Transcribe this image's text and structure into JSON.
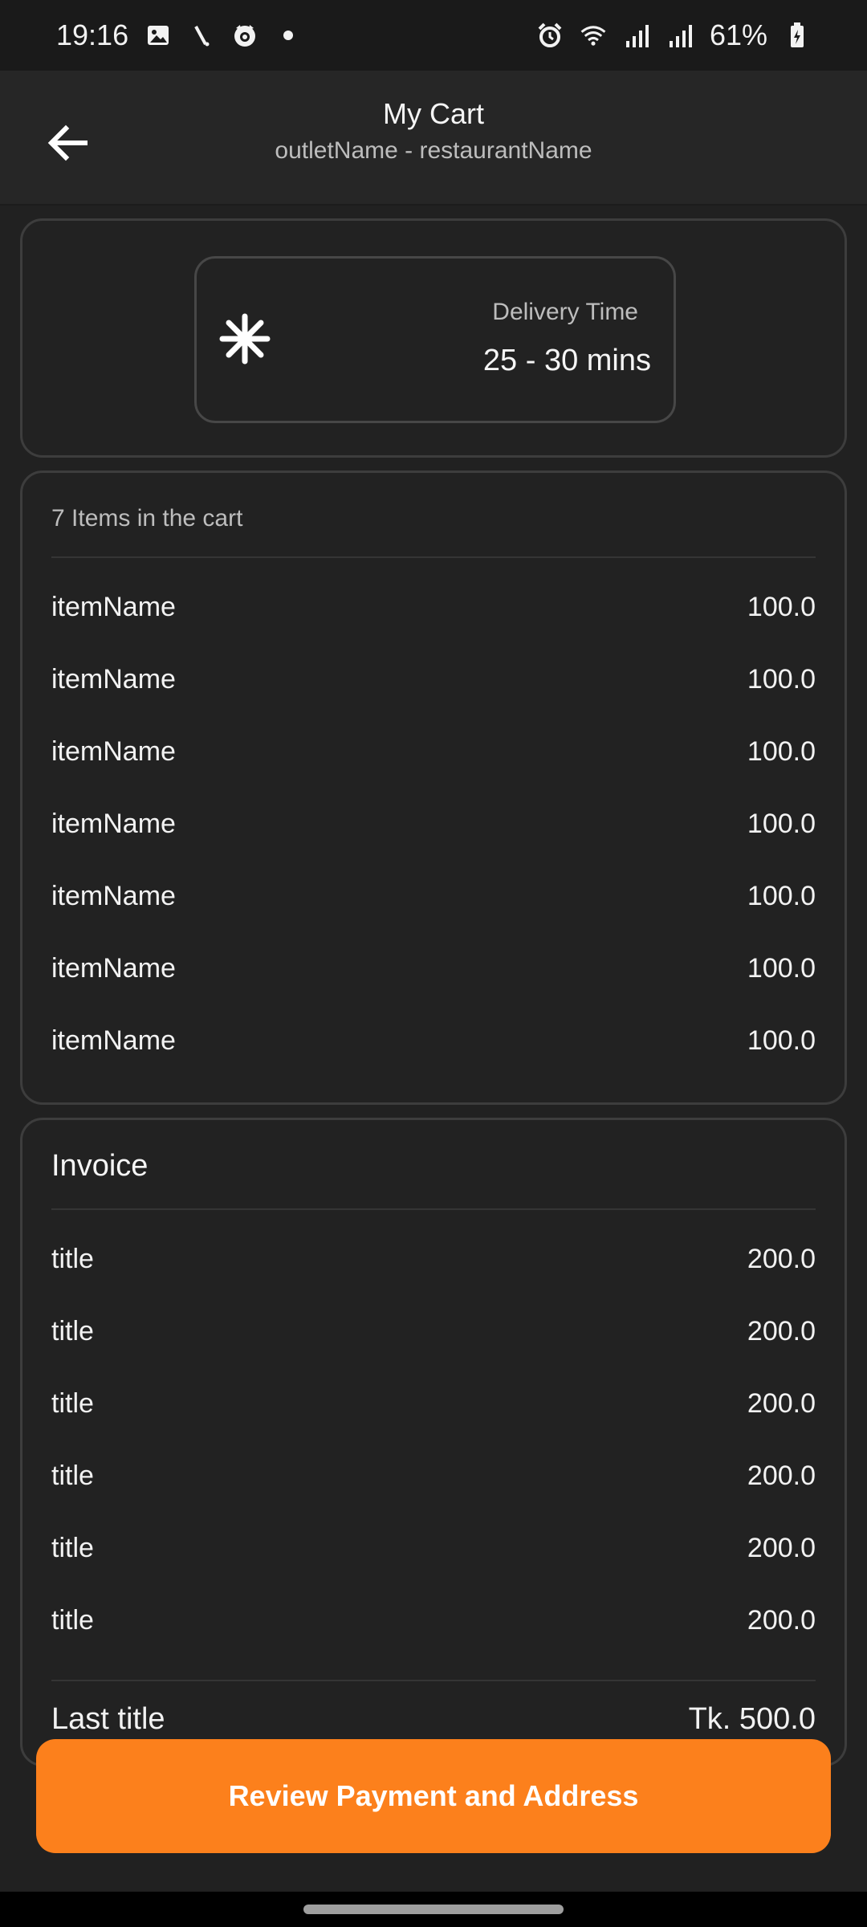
{
  "status_bar": {
    "time": "19:16",
    "battery": "61%",
    "icons_left": [
      "image-icon",
      "slash-icon",
      "face-icon",
      "dot-icon"
    ],
    "icons_right": [
      "alarm-icon",
      "wifi-icon",
      "signal-icon",
      "signal-icon",
      "battery-icon"
    ]
  },
  "header": {
    "title": "My Cart",
    "subtitle": "outletName - restaurantName"
  },
  "delivery": {
    "label": "Delivery Time",
    "value": "25 - 30 mins"
  },
  "cart": {
    "heading": "7 Items in the cart",
    "items": [
      {
        "name": "itemName",
        "price": "100.0"
      },
      {
        "name": "itemName",
        "price": "100.0"
      },
      {
        "name": "itemName",
        "price": "100.0"
      },
      {
        "name": "itemName",
        "price": "100.0"
      },
      {
        "name": "itemName",
        "price": "100.0"
      },
      {
        "name": "itemName",
        "price": "100.0"
      },
      {
        "name": "itemName",
        "price": "100.0"
      }
    ]
  },
  "invoice": {
    "heading": "Invoice",
    "rows": [
      {
        "title": "title",
        "amount": "200.0"
      },
      {
        "title": "title",
        "amount": "200.0"
      },
      {
        "title": "title",
        "amount": "200.0"
      },
      {
        "title": "title",
        "amount": "200.0"
      },
      {
        "title": "title",
        "amount": "200.0"
      },
      {
        "title": "title",
        "amount": "200.0"
      }
    ],
    "total_title": "Last title",
    "total_amount": "Tk. 500.0"
  },
  "cta": {
    "label": "Review Payment and Address"
  },
  "colors": {
    "accent": "#fc801c",
    "background": "#212121"
  }
}
